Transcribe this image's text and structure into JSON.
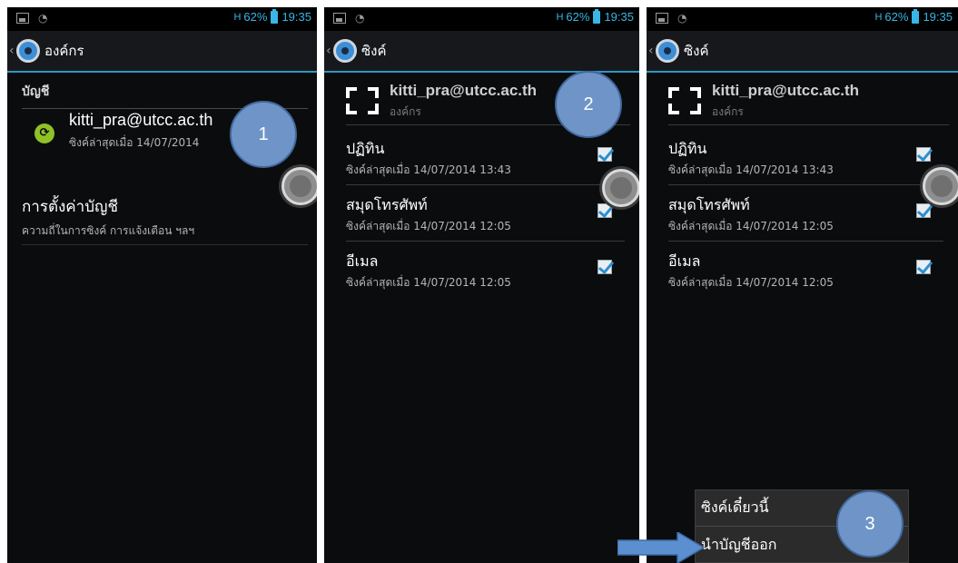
{
  "status": {
    "battery": "62%",
    "time": "19:35",
    "signal_label": "H"
  },
  "panel1": {
    "title": "องค์กร",
    "section_header": "บัญชี",
    "account": {
      "email": "kitti_pra@utcc.ac.th",
      "subtitle": "ซิงค์ล่าสุดเมื่อ 14/07/2014"
    },
    "settings": {
      "title": "การตั้งค่าบัญชี",
      "subtitle": "ความถี่ในการซิงค์ การแจ้งเตือน ฯลฯ"
    },
    "callout": "1"
  },
  "panel2": {
    "title": "ซิงค์",
    "account": {
      "email": "kitti_pra@utcc.ac.th",
      "subtitle": "องค์กร"
    },
    "items": [
      {
        "title": "ปฏิทิน",
        "subtitle": "ซิงค์ล่าสุดเมื่อ 14/07/2014 13:43",
        "checked": true
      },
      {
        "title": "สมุดโทรศัพท์",
        "subtitle": "ซิงค์ล่าสุดเมื่อ 14/07/2014 12:05",
        "checked": true
      },
      {
        "title": "อีเมล",
        "subtitle": "ซิงค์ล่าสุดเมื่อ 14/07/2014 12:05",
        "checked": true
      }
    ],
    "callout": "2"
  },
  "panel3": {
    "title": "ซิงค์",
    "account": {
      "email": "kitti_pra@utcc.ac.th",
      "subtitle": "องค์กร"
    },
    "items": [
      {
        "title": "ปฏิทิน",
        "subtitle": "ซิงค์ล่าสุดเมื่อ 14/07/2014 13:43",
        "checked": true
      },
      {
        "title": "สมุดโทรศัพท์",
        "subtitle": "ซิงค์ล่าสุดเมื่อ 14/07/2014 12:05",
        "checked": true
      },
      {
        "title": "อีเมล",
        "subtitle": "ซิงค์ล่าสุดเมื่อ 14/07/2014 12:05",
        "checked": true
      }
    ],
    "menu": {
      "sync_now": "ซิงค์เดี๋ยวนี้",
      "remove_account": "นำบัญชีออก"
    },
    "callout": "3"
  },
  "colors": {
    "accent": "#2f96c4",
    "callout": "#6f95c8",
    "arrow": "#5b8fd0",
    "sync_green": "#8fc227"
  },
  "icons": [
    "picture-icon",
    "eye-icon",
    "signal-icon",
    "battery-icon",
    "back-caret-icon",
    "settings-gear-icon",
    "sync-icon",
    "corporate-account-icon",
    "checkbox-icon",
    "floating-assistive-button-icon",
    "arrow-right-icon"
  ]
}
